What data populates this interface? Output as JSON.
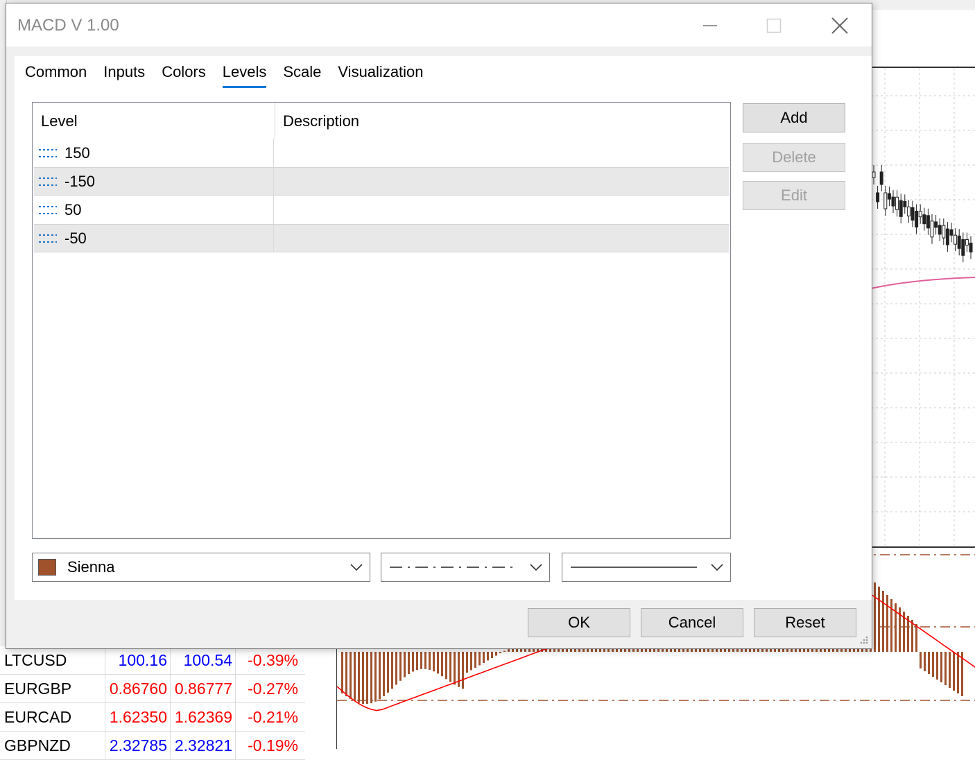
{
  "dialog": {
    "title": "MACD V 1.00",
    "tabs": [
      {
        "label": "Common"
      },
      {
        "label": "Inputs"
      },
      {
        "label": "Colors"
      },
      {
        "label": "Levels"
      },
      {
        "label": "Scale"
      },
      {
        "label": "Visualization"
      }
    ],
    "active_tab": "Levels",
    "levels_table": {
      "columns": [
        "Level",
        "Description"
      ],
      "rows": [
        {
          "level": "150",
          "description": ""
        },
        {
          "level": "-150",
          "description": ""
        },
        {
          "level": "50",
          "description": ""
        },
        {
          "level": "-50",
          "description": ""
        }
      ]
    },
    "side_buttons": {
      "add": "Add",
      "delete": "Delete",
      "edit": "Edit"
    },
    "color_select": {
      "value": "Sienna",
      "color": "#a0522d"
    },
    "footer": {
      "ok": "OK",
      "cancel": "Cancel",
      "reset": "Reset"
    }
  },
  "market_watch": {
    "rows": [
      {
        "symbol": "LTCUSD",
        "bid": "100.16",
        "ask": "100.54",
        "change": "-0.39%"
      },
      {
        "symbol": "EURGBP",
        "bid": "0.86760",
        "ask": "0.86777",
        "change": "-0.27%"
      },
      {
        "symbol": "EURCAD",
        "bid": "1.62350",
        "ask": "1.62369",
        "change": "-0.21%"
      },
      {
        "symbol": "GBPNZD",
        "bid": "2.32785",
        "ask": "2.32821",
        "change": "-0.19%"
      }
    ]
  },
  "colors": {
    "accent": "#0078d7",
    "level_line": "#a0522d",
    "signal_line": "#ff0000",
    "ma_line": "#e0609a"
  }
}
